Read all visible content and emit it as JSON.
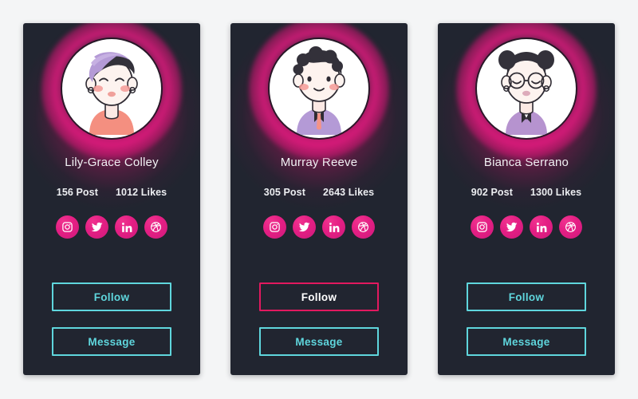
{
  "page": {
    "background_color": "#f4f5f6",
    "card_background_color": "#212530",
    "accent_pink": "#e51f84",
    "accent_cyan": "#5fd6dd",
    "active_border": "#e2195f"
  },
  "social_labels": {
    "instagram": "instagram-icon",
    "twitter": "twitter-icon",
    "linkedin": "linkedin-icon",
    "dribbble": "dribbble-icon"
  },
  "cards": [
    {
      "name": "Lily-Grace Colley",
      "posts": "156 Post",
      "likes": "1012 Likes",
      "follow_label": "Follow",
      "message_label": "Message",
      "follow_active": false,
      "avatar": {
        "hair_color": "#b49ad6",
        "shirt_color": "#f48f80",
        "eyes": "closed",
        "glasses": false
      }
    },
    {
      "name": "Murray Reeve",
      "posts": "305 Post",
      "likes": "2643 Likes",
      "follow_label": "Follow",
      "message_label": "Message",
      "follow_active": true,
      "avatar": {
        "hair_color": "#33313a",
        "shirt_color": "#b49ad6",
        "eyes": "open",
        "glasses": false
      }
    },
    {
      "name": "Bianca Serrano",
      "posts": "902 Post",
      "likes": "1300 Likes",
      "follow_label": "Follow",
      "message_label": "Message",
      "follow_active": false,
      "avatar": {
        "hair_color": "#33313a",
        "shirt_color": "#b693cf",
        "eyes": "closed",
        "glasses": true
      }
    }
  ]
}
